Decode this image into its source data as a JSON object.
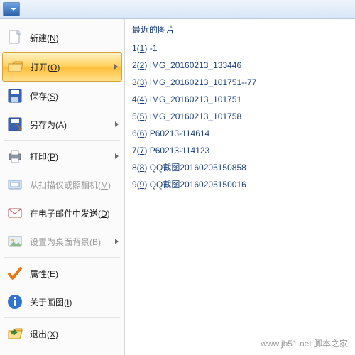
{
  "menu": {
    "items": [
      {
        "key": "N",
        "label": "新建",
        "name": "menu-new",
        "icon": "new"
      },
      {
        "key": "O",
        "label": "打开",
        "name": "menu-open",
        "icon": "open",
        "selected": true,
        "arrow": true
      },
      {
        "key": "S",
        "label": "保存",
        "name": "menu-save",
        "icon": "save"
      },
      {
        "key": "A",
        "label": "另存为",
        "name": "menu-saveas",
        "icon": "saveas",
        "arrow": true
      },
      {
        "sep": true
      },
      {
        "key": "P",
        "label": "打印",
        "name": "menu-print",
        "icon": "print",
        "arrow": true
      },
      {
        "key": "M",
        "label": "从扫描仪或照相机",
        "name": "menu-scan",
        "icon": "scan",
        "dim": true
      },
      {
        "key": "D",
        "label": "在电子邮件中发送",
        "name": "menu-email",
        "icon": "email"
      },
      {
        "key": "B",
        "label": "设置为桌面背景",
        "name": "menu-wallpaper",
        "icon": "wallpaper",
        "dim": true,
        "arrow": true
      },
      {
        "sep": true
      },
      {
        "key": "E",
        "label": "属性",
        "name": "menu-properties",
        "icon": "check"
      },
      {
        "key": "I",
        "label": "关于画图",
        "name": "menu-about",
        "icon": "info"
      },
      {
        "sep": true
      },
      {
        "key": "X",
        "label": "退出",
        "name": "menu-exit",
        "icon": "exit"
      }
    ]
  },
  "recent": {
    "header": "最近的图片",
    "items": [
      {
        "n": 1,
        "k": "1",
        "label": "-1"
      },
      {
        "n": 2,
        "k": "2",
        "label": "IMG_20160213_133446"
      },
      {
        "n": 3,
        "k": "3",
        "label": "IMG_20160213_101751--77"
      },
      {
        "n": 4,
        "k": "4",
        "label": "IMG_20160213_101751"
      },
      {
        "n": 5,
        "k": "5",
        "label": "IMG_20160213_101758"
      },
      {
        "n": 6,
        "k": "6",
        "label": "P60213-114614"
      },
      {
        "n": 7,
        "k": "7",
        "label": "P60213-114123"
      },
      {
        "n": 8,
        "k": "8",
        "label": "QQ截图20160205150858"
      },
      {
        "n": 9,
        "k": "9",
        "label": "QQ截图20160205150016"
      }
    ]
  },
  "watermark": "www.jb51.net  脚本之家"
}
